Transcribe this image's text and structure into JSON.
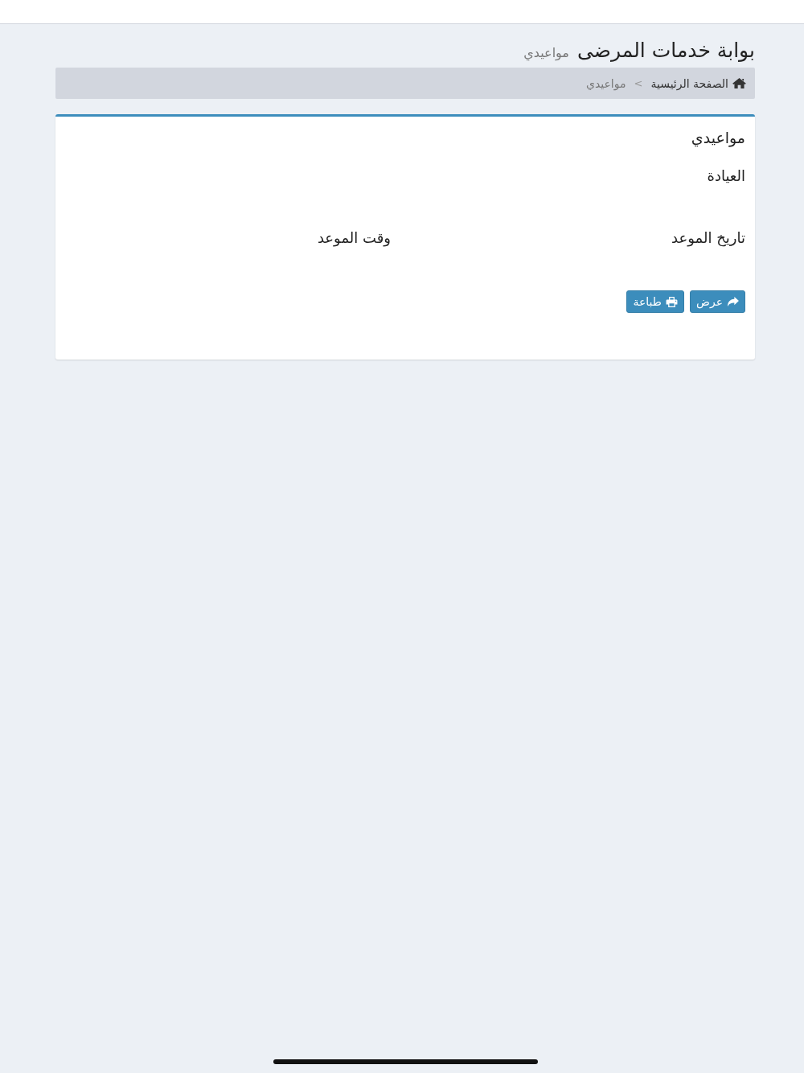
{
  "header": {
    "title": "بوابة خدمات المرضى",
    "subtitle": "مواعيدي"
  },
  "breadcrumb": {
    "separator": ">",
    "items": [
      {
        "label": "الصفحة الرئيسية",
        "kind": "home"
      },
      {
        "label": "مواعيدي",
        "kind": "current"
      }
    ]
  },
  "card": {
    "title": "مواعيدي",
    "clinic_label": "العيادة",
    "columns": [
      "تاريخ الموعد",
      "وقت الموعد"
    ],
    "buttons": [
      {
        "label": "عرض",
        "kind": "view"
      },
      {
        "label": "طباعة",
        "kind": "print"
      }
    ]
  }
}
